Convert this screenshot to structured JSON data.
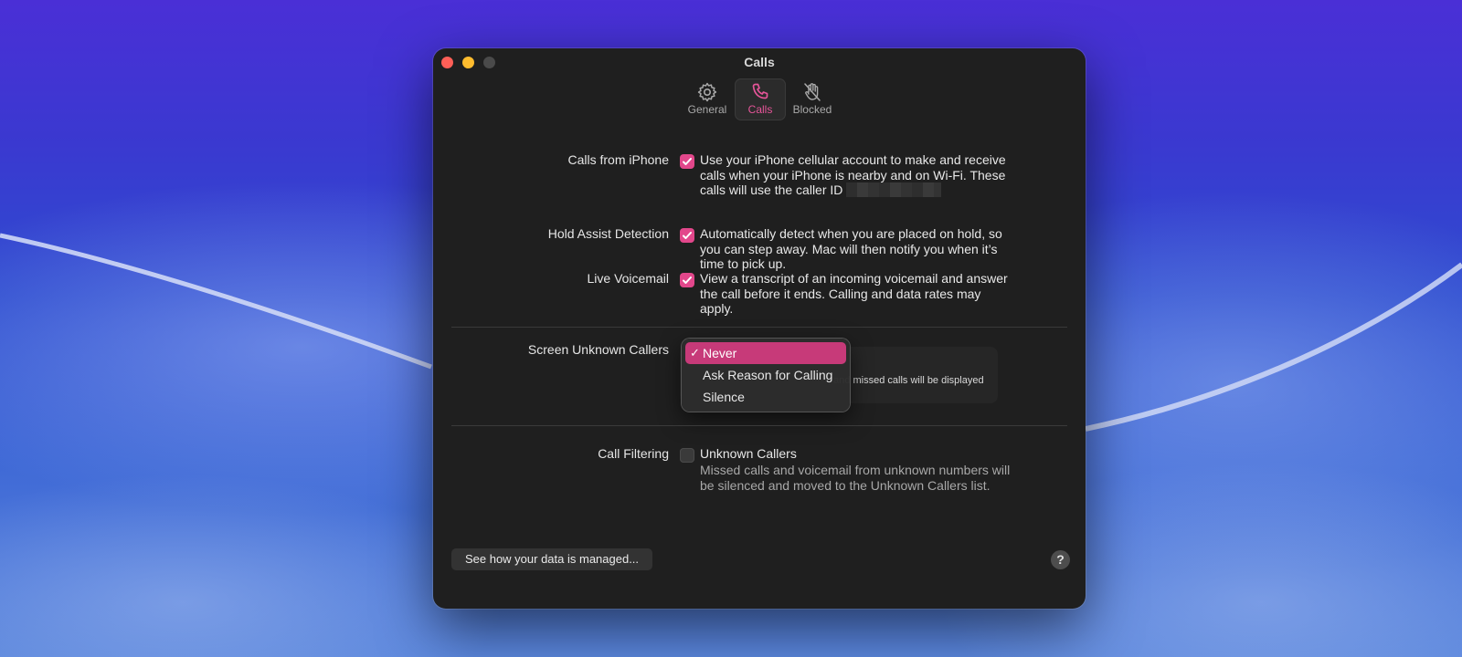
{
  "window": {
    "title": "Calls"
  },
  "toolbar": {
    "tabs": [
      {
        "label": "General",
        "icon": "gear-icon"
      },
      {
        "label": "Calls",
        "icon": "phone-icon",
        "selected": true
      },
      {
        "label": "Blocked",
        "icon": "hand-raised-slash-icon"
      }
    ]
  },
  "settings": {
    "calls_from_iphone": {
      "label": "Calls from iPhone",
      "checked": true,
      "description": "Use your iPhone cellular account to make and receive calls when your iPhone is nearby and on Wi-Fi. These calls will use the caller ID"
    },
    "hold_assist": {
      "label": "Hold Assist Detection",
      "checked": true,
      "description": "Automatically detect when you are placed on hold, so you can step away. Mac will then notify you when it’s time to pick up."
    },
    "live_voicemail": {
      "label": "Live Voicemail",
      "checked": true,
      "description": "View a transcript of an incoming voicemail and answer the call before it ends. Calling and data rates may apply."
    },
    "screen_unknown": {
      "label": "Screen Unknown Callers",
      "behind_text": ", and missed calls will be displayed",
      "menu_options": [
        "Never",
        "Ask Reason for Calling",
        "Silence"
      ],
      "selected": "Never"
    },
    "call_filtering": {
      "label": "Call Filtering",
      "checked": false,
      "option_label": "Unknown Callers",
      "description": "Missed calls and voicemail from unknown numbers will be silenced and moved to the Unknown Callers list."
    }
  },
  "footer": {
    "data_button": "See how your data is managed...",
    "help_label": "?"
  },
  "colors": {
    "accent": "#e2478b",
    "menu_selection": "#c73a79",
    "window_bg": "#1f1f1f"
  }
}
